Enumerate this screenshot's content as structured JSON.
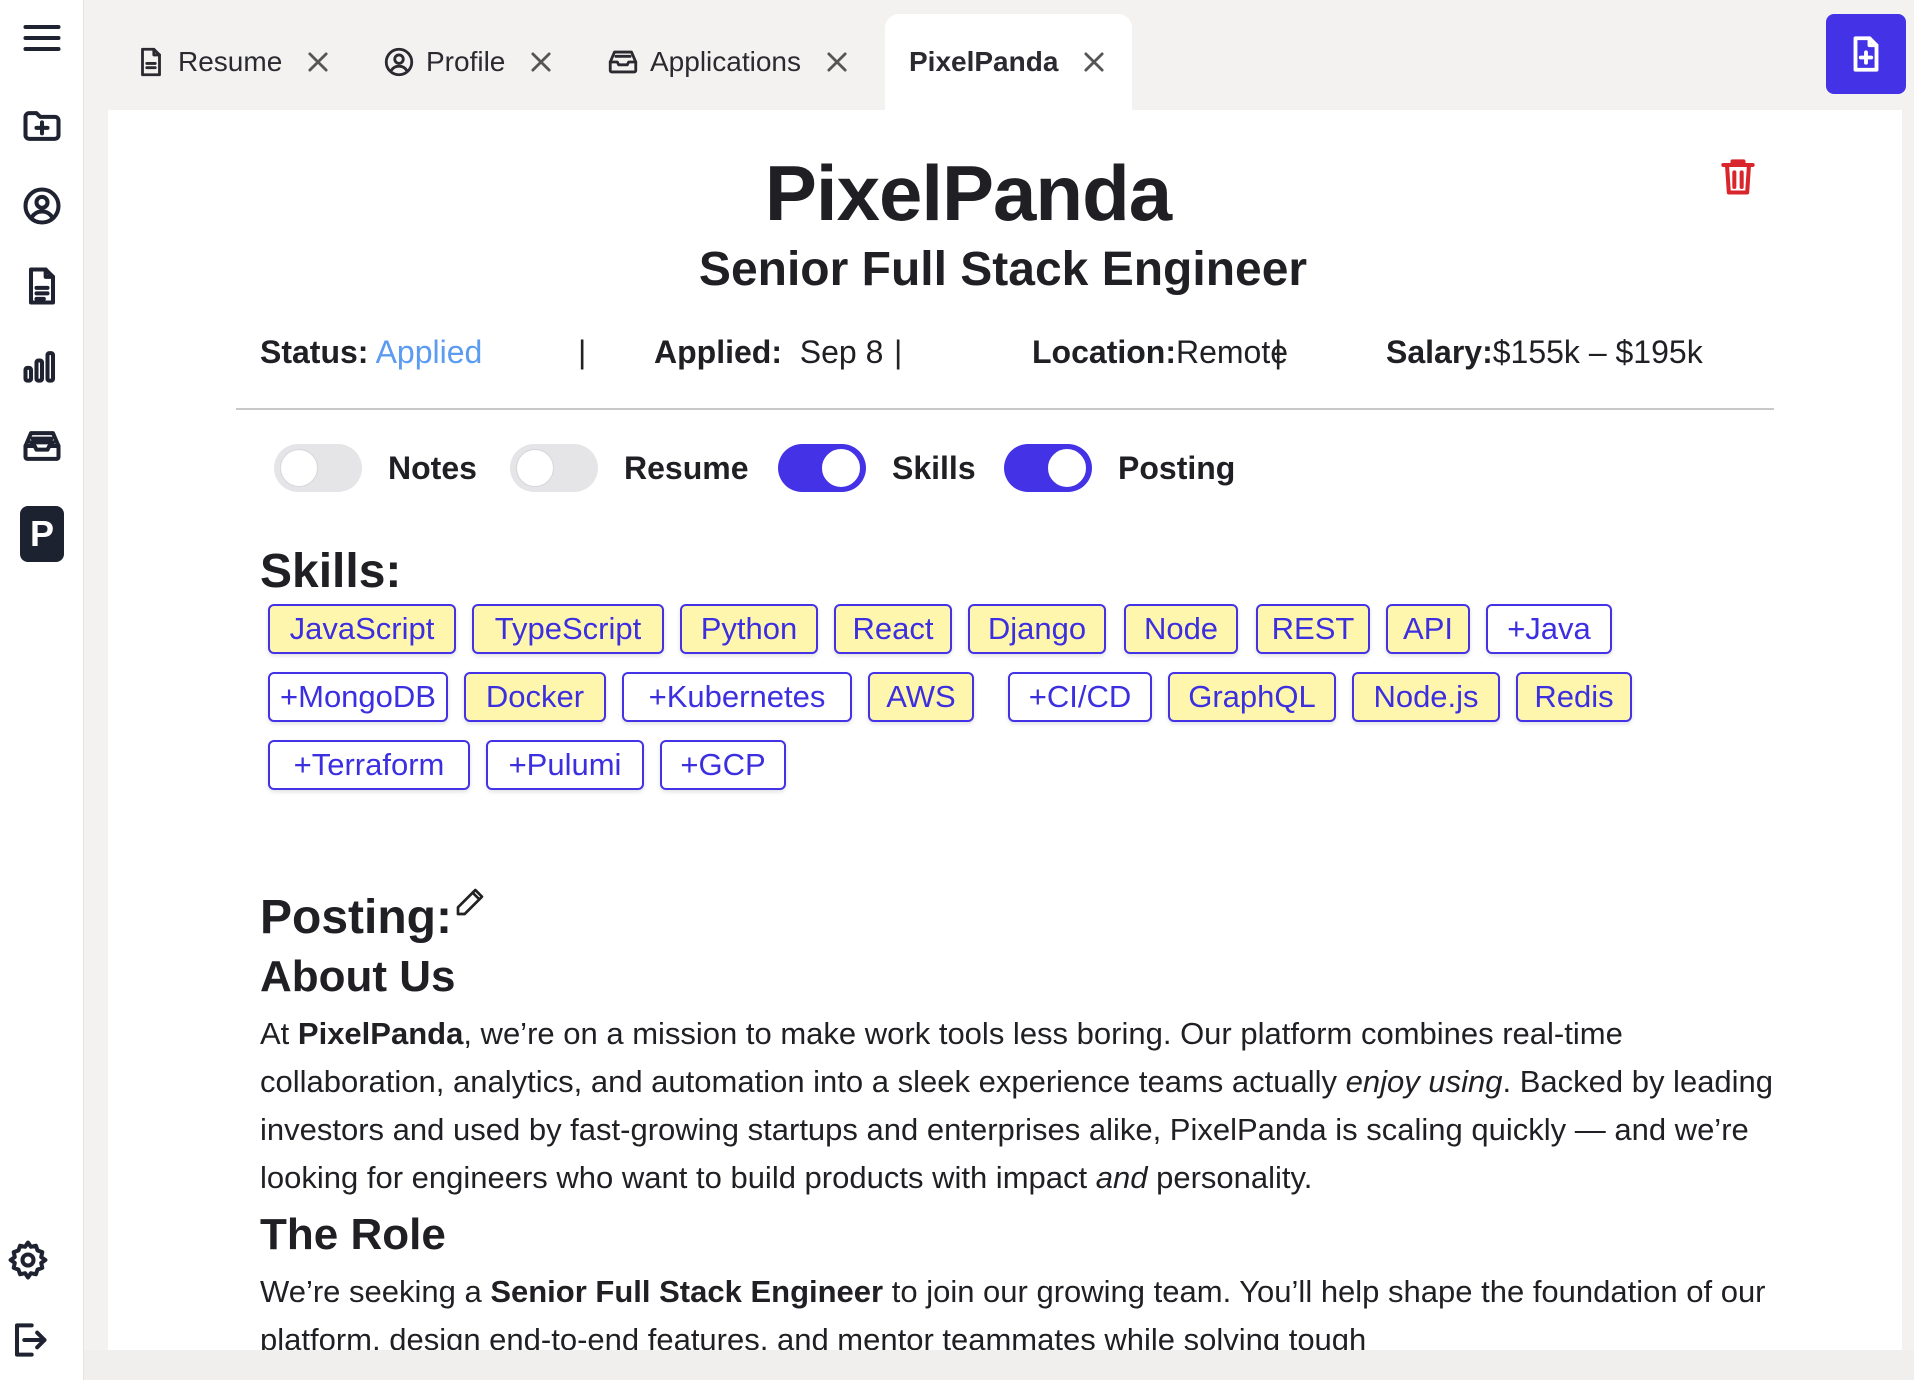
{
  "sidebar": {
    "items": [
      {
        "icon": "menu-icon"
      },
      {
        "icon": "folder-plus-icon"
      },
      {
        "icon": "user-circle-icon"
      },
      {
        "icon": "document-icon"
      },
      {
        "icon": "bar-chart-icon"
      },
      {
        "icon": "inbox-icon"
      },
      {
        "badge": "P"
      },
      {
        "icon": "gear-icon"
      },
      {
        "icon": "logout-icon"
      }
    ]
  },
  "tabs": [
    {
      "label": "Resume",
      "icon": "document-icon"
    },
    {
      "label": "Profile",
      "icon": "user-circle-icon"
    },
    {
      "label": "Applications",
      "icon": "inbox-icon"
    },
    {
      "label": "PixelPanda",
      "active": true
    }
  ],
  "job": {
    "company": "PixelPanda",
    "role": "Senior Full Stack Engineer",
    "status_label": "Status:",
    "status_value": "Applied",
    "applied_label": "Applied:",
    "applied_value": "Sep 8",
    "location_label": "Location:",
    "location_value": "Remote",
    "salary_label": "Salary:",
    "salary_value": "$155k – $195k",
    "separator": "|"
  },
  "toggles": [
    {
      "label": "Notes",
      "on": false
    },
    {
      "label": "Resume",
      "on": false
    },
    {
      "label": "Skills",
      "on": true
    },
    {
      "label": "Posting",
      "on": true
    }
  ],
  "skills": {
    "heading": "Skills:",
    "items": [
      {
        "label": "JavaScript",
        "kind": "have"
      },
      {
        "label": "TypeScript",
        "kind": "have"
      },
      {
        "label": "Python",
        "kind": "have"
      },
      {
        "label": "React",
        "kind": "have"
      },
      {
        "label": "Django",
        "kind": "have"
      },
      {
        "label": "Node",
        "kind": "have"
      },
      {
        "label": "REST",
        "kind": "have"
      },
      {
        "label": "API",
        "kind": "have"
      },
      {
        "label": "+Java",
        "kind": "add"
      },
      {
        "label": "+MongoDB",
        "kind": "add"
      },
      {
        "label": "Docker",
        "kind": "have"
      },
      {
        "label": "+Kubernetes",
        "kind": "add"
      },
      {
        "label": "AWS",
        "kind": "have"
      },
      {
        "label": "+CI/CD",
        "kind": "add"
      },
      {
        "label": "GraphQL",
        "kind": "have"
      },
      {
        "label": "Node.js",
        "kind": "have"
      },
      {
        "label": "Redis",
        "kind": "have"
      },
      {
        "label": "+Terraform",
        "kind": "add"
      },
      {
        "label": "+Pulumi",
        "kind": "add"
      },
      {
        "label": "+GCP",
        "kind": "add"
      }
    ]
  },
  "posting": {
    "heading": "Posting:",
    "about_heading": "About Us",
    "about_parts": [
      {
        "t": "At "
      },
      {
        "t": "PixelPanda",
        "style": "b"
      },
      {
        "t": ", we’re on a mission to make work tools less boring. Our platform combines real-time collaboration, analytics, and automation into a sleek experience teams actually "
      },
      {
        "t": "enjoy using",
        "style": "i"
      },
      {
        "t": ". Backed by leading investors and used by fast-growing startups and enterprises alike, PixelPanda is scaling quickly — and we’re looking for engineers who want to build products with impact "
      },
      {
        "t": "and",
        "style": "i"
      },
      {
        "t": " personality."
      }
    ],
    "role_heading": "The Role",
    "role_parts": [
      {
        "t": "We’re seeking a "
      },
      {
        "t": "Senior Full Stack Engineer",
        "style": "b"
      },
      {
        "t": " to join our growing team. You’ll help shape the foundation of our platform, design end-to-end features, and mentor teammates while solving tough"
      }
    ]
  },
  "colors": {
    "accent": "#4433e6",
    "status": "#5b9bf0",
    "skill_have_bg": "#fff6ae",
    "danger": "#d9262c"
  }
}
